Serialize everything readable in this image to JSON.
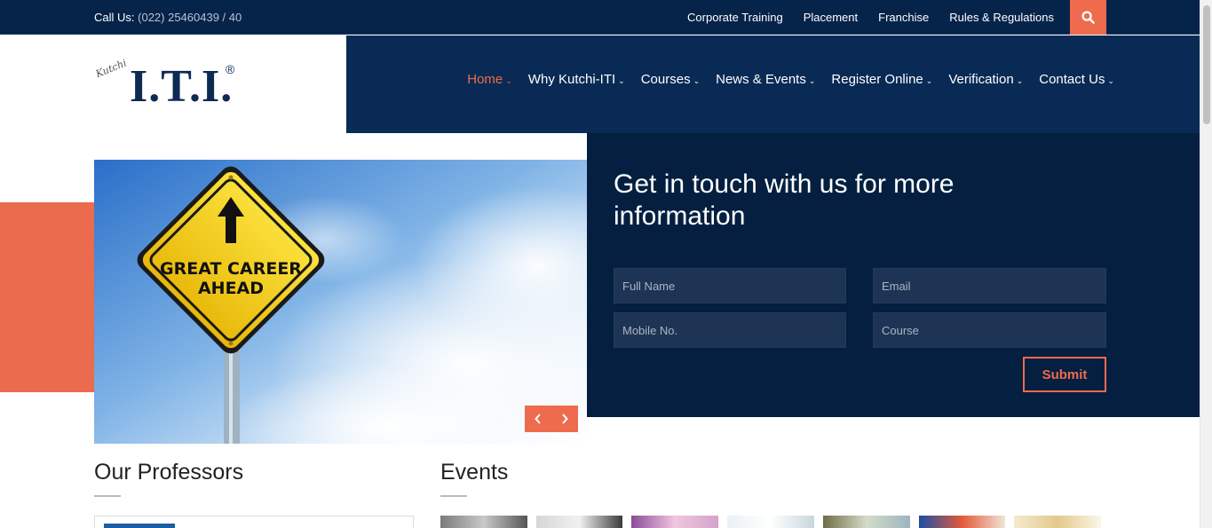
{
  "topbar": {
    "call_label": "Call Us:",
    "call_number": "(022) 25460439 / 40",
    "links": [
      "Corporate Training",
      "Placement",
      "Franchise",
      "Rules & Regulations"
    ]
  },
  "logo": {
    "small_text": "Kutchi",
    "main_text": "I.T.I.",
    "reg_mark": "®"
  },
  "nav": {
    "items": [
      {
        "label": "Home",
        "active": true
      },
      {
        "label": "Why Kutchi-ITI"
      },
      {
        "label": "Courses"
      },
      {
        "label": "News & Events"
      },
      {
        "label": "Register Online"
      },
      {
        "label": "Verification"
      },
      {
        "label": "Contact Us"
      }
    ]
  },
  "slider": {
    "sign_line1": "GREAT CAREER",
    "sign_line2": "AHEAD"
  },
  "contact_form": {
    "title": "Get in touch with us for more information",
    "full_name_placeholder": "Full Name",
    "email_placeholder": "Email",
    "mobile_placeholder": "Mobile No.",
    "course_placeholder": "Course",
    "submit_label": "Submit"
  },
  "sections": {
    "professors_title": "Our Professors",
    "events_title": "Events"
  },
  "colors": {
    "navy": "#06234a",
    "accent": "#ee6b4d"
  }
}
